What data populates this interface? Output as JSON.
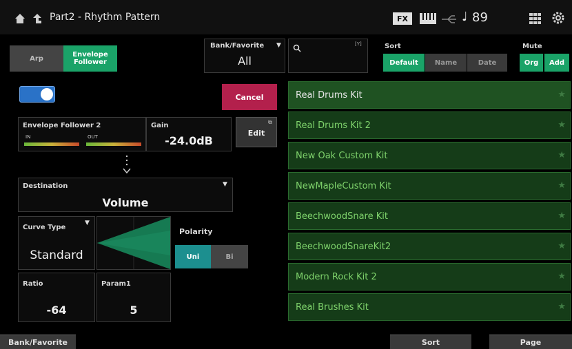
{
  "header": {
    "title": "Part2 - Rhythm Pattern",
    "fx_badge": "FX",
    "tempo": "89"
  },
  "arp_tabs": {
    "arp": "Arp",
    "env_line1": "Envelope",
    "env_line2": "Follower"
  },
  "bank_favorite": {
    "label": "Bank/Favorite",
    "value": "All"
  },
  "search": {
    "placeholder": "",
    "hint": "[Y]"
  },
  "sort": {
    "label": "Sort",
    "options": [
      "Default",
      "Name",
      "Date"
    ]
  },
  "mute": {
    "label": "Mute",
    "options": [
      "Org",
      "Add"
    ]
  },
  "cancel_label": "Cancel",
  "env_follower": {
    "label": "Envelope Follower 2",
    "in_label": "IN",
    "out_label": "OUT"
  },
  "gain": {
    "label": "Gain",
    "value": "-24.0dB"
  },
  "edit_label": "Edit",
  "destination": {
    "label": "Destination",
    "value": "Volume"
  },
  "curve_type": {
    "label": "Curve Type",
    "value": "Standard"
  },
  "polarity": {
    "label": "Polarity",
    "options": [
      "Uni",
      "Bi"
    ]
  },
  "ratio": {
    "label": "Ratio",
    "value": "-64"
  },
  "param1": {
    "label": "Param1",
    "value": "5"
  },
  "list": [
    "Real Drums Kit",
    "Real Drums Kit 2",
    "New Oak Custom Kit",
    "NewMapleCustom Kit",
    "BeechwoodSnare Kit",
    "BeechwoodSnareKit2",
    "Modern Rock Kit 2",
    "Real Brushes Kit"
  ],
  "bottom": {
    "bank_favorite": "Bank/Favorite",
    "sort": "Sort",
    "page": "Page"
  },
  "colors": {
    "accent_green": "#1aa368",
    "teal": "#1c8f8f",
    "cancel": "#b3204c",
    "list_bg": "#153c18"
  }
}
